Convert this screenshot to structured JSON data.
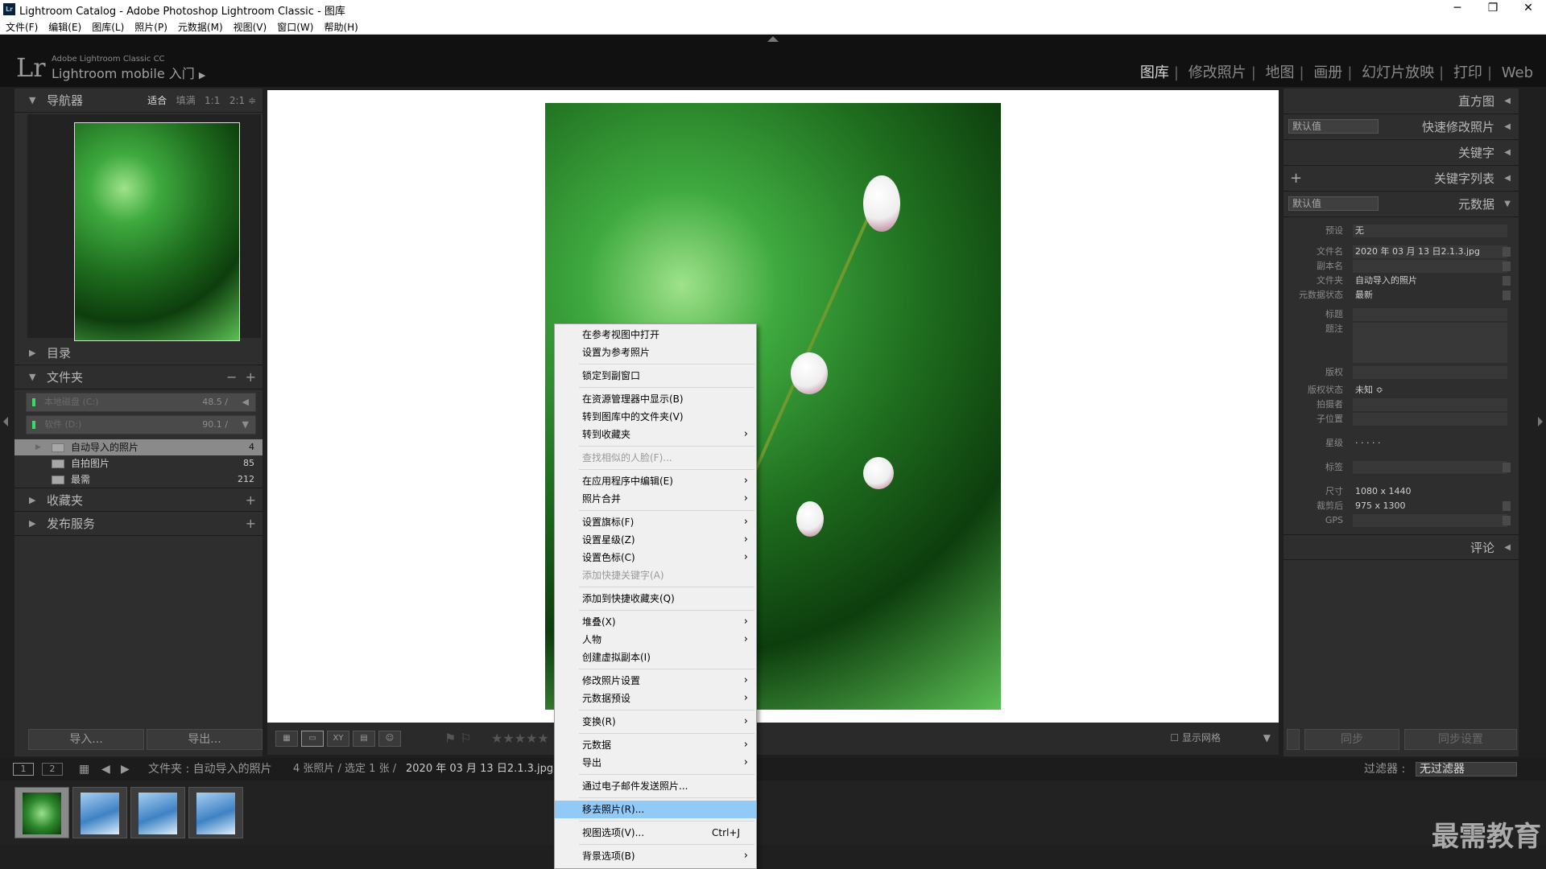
{
  "window": {
    "title": "Lightroom Catalog - Adobe Photoshop Lightroom Classic - 图库",
    "logo": "Lr"
  },
  "menu": [
    "文件(F)",
    "编辑(E)",
    "图库(L)",
    "照片(P)",
    "元数据(M)",
    "视图(V)",
    "窗口(W)",
    "帮助(H)"
  ],
  "identity": {
    "logo": "Lr",
    "small": "Adobe Lightroom Classic CC",
    "main": "Lightroom mobile 入门",
    "arrow": "▶"
  },
  "modules": [
    "图库",
    "修改照片",
    "地图",
    "画册",
    "幻灯片放映",
    "打印",
    "Web"
  ],
  "navigator": {
    "title": "导航器",
    "opts": [
      "适合",
      "填满",
      "1:1",
      "2:1"
    ]
  },
  "left_panels": {
    "catalog": "目录",
    "folders": "文件夹",
    "collections": "收藏夹",
    "publish": "发布服务"
  },
  "volumes": [
    {
      "name": "本地磁盘 (C:)",
      "value": "48.5 /"
    },
    {
      "name": "软件 (D:)",
      "value": "90.1 /"
    }
  ],
  "folders": [
    {
      "name": "自动导入的照片",
      "count": "4"
    },
    {
      "name": "自拍图片",
      "count": "85"
    },
    {
      "name": "最需",
      "count": "212"
    }
  ],
  "left_buttons": {
    "import": "导入...",
    "export": "导出..."
  },
  "toolbar": {
    "show_grid": "显示网格",
    "stars": "★★★★★"
  },
  "right": {
    "histogram": "直方图",
    "quick_develop": "快速修改照片",
    "keywording": "关键字",
    "keyword_list": "关键字列表",
    "metadata": "元数据",
    "preset_default": "默认值",
    "comments": "评论",
    "sync": "同步",
    "sync_settings": "同步设置"
  },
  "metadata": [
    {
      "label": "预设",
      "value": "无"
    },
    {
      "label": "文件名",
      "value": "2020 年 03 月 13 日2.1.3.jpg"
    },
    {
      "label": "副本名",
      "value": ""
    },
    {
      "label": "文件夹",
      "value": "自动导入的照片"
    },
    {
      "label": "元数据状态",
      "value": "最新"
    },
    {
      "label": "标题",
      "value": ""
    },
    {
      "label": "题注",
      "value": ""
    },
    {
      "label": "版权",
      "value": ""
    },
    {
      "label": "版权状态",
      "value": "未知 ≎"
    },
    {
      "label": "拍摄者",
      "value": ""
    },
    {
      "label": "子位置",
      "value": ""
    },
    {
      "label": "星级",
      "value": "· · · · ·"
    },
    {
      "label": "标签",
      "value": ""
    },
    {
      "label": "尺寸",
      "value": "1080 x 1440"
    },
    {
      "label": "裁剪后",
      "value": "975 x 1300"
    },
    {
      "label": "GPS",
      "value": ""
    }
  ],
  "status": {
    "pages": [
      "1",
      "2"
    ],
    "path": "文件夹 : 自动导入的照片",
    "info": "4 张照片 / 选定 1 张 /",
    "file": "2020 年 03 月 13 日2.1.3.jpg",
    "filter_label": "过滤器 :",
    "filter_value": "无过滤器"
  },
  "watermark": "最需教育",
  "context_menu": [
    {
      "label": "在参考视图中打开"
    },
    {
      "label": "设置为参考照片"
    },
    {
      "sep": true
    },
    {
      "label": "锁定到副窗口"
    },
    {
      "sep": true
    },
    {
      "label": "在资源管理器中显示(B)"
    },
    {
      "label": "转到图库中的文件夹(V)"
    },
    {
      "label": "转到收藏夹",
      "sub": true
    },
    {
      "sep": true
    },
    {
      "label": "查找相似的人脸(F)...",
      "disabled": true
    },
    {
      "sep": true
    },
    {
      "label": "在应用程序中编辑(E)",
      "sub": true
    },
    {
      "label": "照片合并",
      "sub": true
    },
    {
      "sep": true
    },
    {
      "label": "设置旗标(F)",
      "sub": true
    },
    {
      "label": "设置星级(Z)",
      "sub": true
    },
    {
      "label": "设置色标(C)",
      "sub": true
    },
    {
      "label": "添加快捷关键字(A)",
      "disabled": true
    },
    {
      "sep": true
    },
    {
      "label": "添加到快捷收藏夹(Q)"
    },
    {
      "sep": true
    },
    {
      "label": "堆叠(X)",
      "sub": true
    },
    {
      "label": "人物",
      "sub": true
    },
    {
      "label": "创建虚拟副本(I)"
    },
    {
      "sep": true
    },
    {
      "label": "修改照片设置",
      "sub": true
    },
    {
      "label": "元数据预设",
      "sub": true
    },
    {
      "sep": true
    },
    {
      "label": "变换(R)",
      "sub": true
    },
    {
      "sep": true
    },
    {
      "label": "元数据",
      "sub": true
    },
    {
      "label": "导出",
      "sub": true
    },
    {
      "sep": true
    },
    {
      "label": "通过电子邮件发送照片..."
    },
    {
      "sep": true
    },
    {
      "label": "移去照片(R)...",
      "highlight": true
    },
    {
      "sep": true
    },
    {
      "label": "视图选项(V)...",
      "shortcut": "Ctrl+J"
    },
    {
      "sep": true
    },
    {
      "label": "背景选项(B)",
      "sub": true
    }
  ]
}
